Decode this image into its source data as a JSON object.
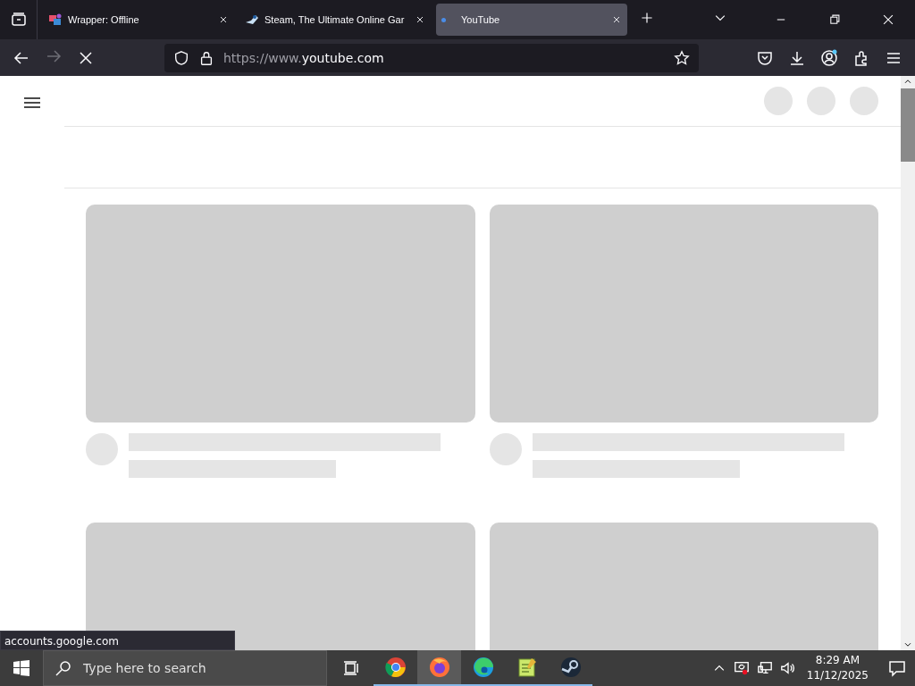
{
  "tabs": [
    {
      "title": "Wrapper: Offline",
      "selected": false
    },
    {
      "title": "Steam, The Ultimate Online Gar",
      "selected": false
    },
    {
      "title": "YouTube",
      "selected": true
    }
  ],
  "address_bar": {
    "scheme": "https://www.",
    "host": "youtube.com"
  },
  "status_text": "accounts.google.com",
  "taskbar": {
    "search_placeholder": "Type here to search",
    "apps": [
      {
        "kind": "chrome",
        "selected": false
      },
      {
        "kind": "firefox",
        "selected": true
      },
      {
        "kind": "edge",
        "selected": false
      },
      {
        "kind": "notepad",
        "selected": false
      },
      {
        "kind": "steam",
        "selected": false
      }
    ],
    "time": "8:29 AM",
    "date": "11/12/2025"
  }
}
